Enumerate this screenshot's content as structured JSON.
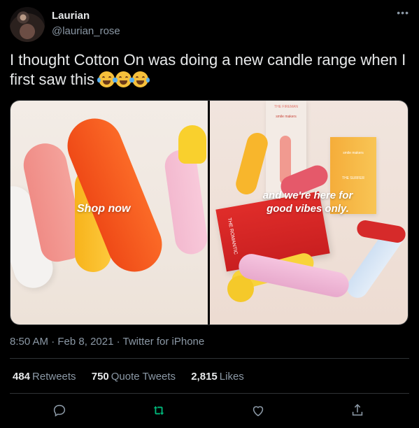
{
  "author": {
    "name": "Laurian",
    "handle": "@laurian_rose",
    "more_icon": "ellipsis-icon"
  },
  "tweet": {
    "text": "I thought Cotton On was doing a new candle range when I first saw this",
    "emojis": [
      "face-with-tears-of-joy",
      "loudly-crying-face",
      "face-with-tears-of-joy"
    ]
  },
  "media": {
    "left_overlay": "Shop now",
    "right_overlay_line1": "and we're here for",
    "right_overlay_line2": "good vibes only.",
    "box_brand": "smile makers",
    "box_label_fireman": "THE FIREMAN",
    "box_label_surfer": "THE SURFER",
    "box_label_romantic": "THE ROMANTIC"
  },
  "meta": {
    "time": "8:50 AM",
    "sep1": " · ",
    "date": "Feb 8, 2021",
    "sep2": " · ",
    "source": "Twitter for iPhone"
  },
  "stats": {
    "retweets_count": "484",
    "retweets_label": "Retweets",
    "quotes_count": "750",
    "quotes_label": "Quote Tweets",
    "likes_count": "2,815",
    "likes_label": "Likes"
  },
  "actions": {
    "reply_icon": "reply-icon",
    "retweet_icon": "retweet-icon",
    "like_icon": "heart-icon",
    "share_icon": "share-icon",
    "retweet_color": "#00ba7c"
  }
}
